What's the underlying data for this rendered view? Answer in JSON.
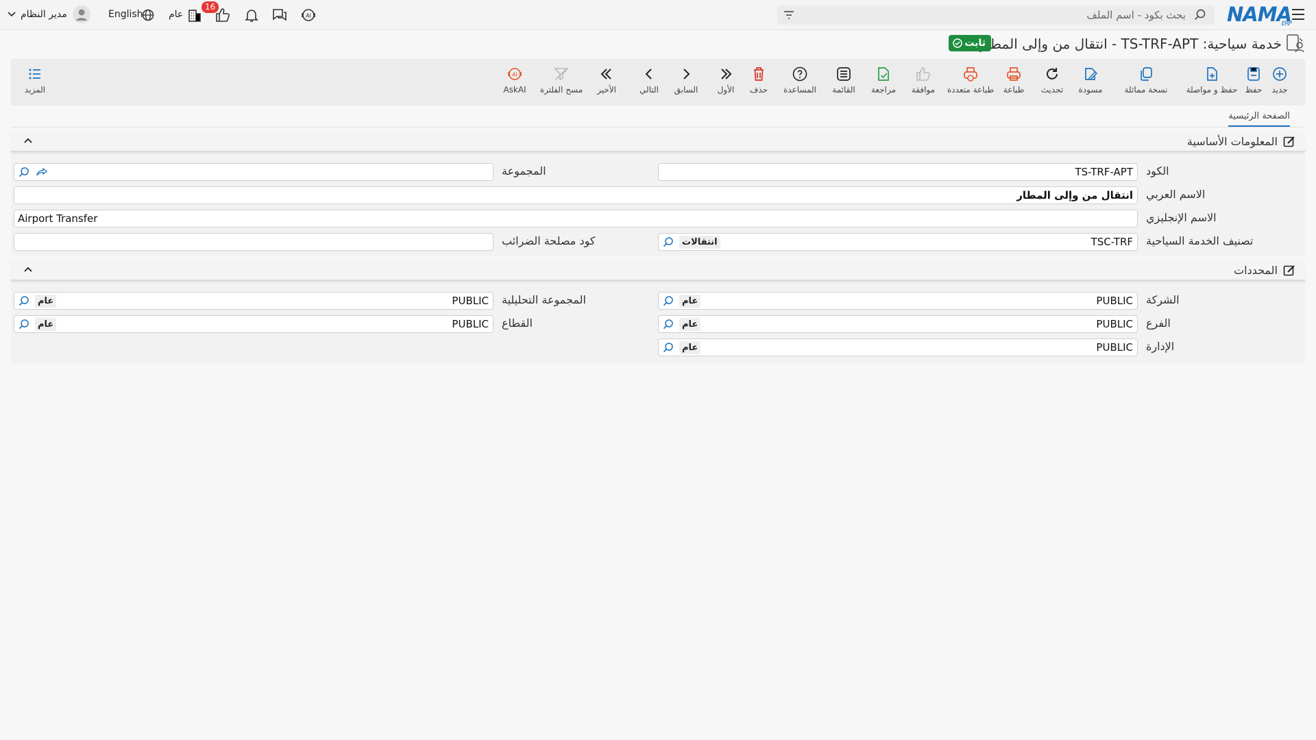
{
  "topbar": {
    "logo": "NAMA",
    "logo_sub": "ERP",
    "search_placeholder": "بحث بكود - اسم الملف",
    "user_name": "مدير النظام",
    "language": "English",
    "scope": "عام",
    "notification_count": "16"
  },
  "page": {
    "title": "خدمة سياحية: TS-TRF-APT - انتقال من وإلى المطار",
    "status": "ثابت"
  },
  "toolbar": {
    "new": "جديد",
    "save": "حفظ",
    "save_continue": "حفظ و مواصلة",
    "duplicate": "نسخة مماثلة",
    "draft": "مسودة",
    "refresh": "تحديث",
    "print": "طباعة",
    "multi_print": "طباعة متعددة",
    "approve": "موافقة",
    "review": "مراجعة",
    "list": "القائمة",
    "help": "المساعدة",
    "delete": "حذف",
    "first": "الأول",
    "previous": "السابق",
    "next": "التالي",
    "last": "الأخير",
    "clear_filter": "مسح الفلترة",
    "askai": "AskAI",
    "more": "المزيد"
  },
  "tabs": {
    "main": "الصفحة الرئيسية"
  },
  "basic": {
    "title": "المعلومات الأساسية",
    "code_label": "الكود",
    "code_value": "TS-TRF-APT",
    "group_label": "المجموعة",
    "group_value": "",
    "arabic_name_label": "الاسم العربي",
    "arabic_name_value": "انتقال من وإلى المطار",
    "english_name_label": "الاسم الإنجليزي",
    "english_name_value": "Airport Transfer",
    "classification_label": "تصنيف الخدمة السياحية",
    "classification_code": "TSC-TRF",
    "classification_name": "انتقالات",
    "tax_code_label": "كود مصلحة الضرائب",
    "tax_code_value": ""
  },
  "dimensions": {
    "title": "المحددات",
    "company_label": "الشركة",
    "company_code": "PUBLIC",
    "company_name": "عام",
    "analysis_group_label": "المجموعة التحليلية",
    "analysis_group_code": "PUBLIC",
    "analysis_group_name": "عام",
    "branch_label": "الفرع",
    "branch_code": "PUBLIC",
    "branch_name": "عام",
    "sector_label": "القطاع",
    "sector_code": "PUBLIC",
    "sector_name": "عام",
    "department_label": "الإدارة",
    "department_code": "PUBLIC",
    "department_name": "عام"
  },
  "colors": {
    "accent": "#1e73be",
    "status_green": "#1e8e3e",
    "badge_red": "#e53935",
    "print_orange": "#e8542b"
  }
}
